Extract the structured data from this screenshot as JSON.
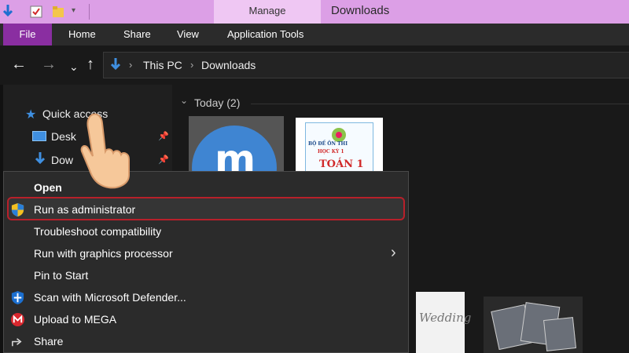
{
  "titlebar": {
    "manage_tab": "Manage",
    "window_title": "Downloads"
  },
  "ribbon": {
    "file": "File",
    "home": "Home",
    "share": "Share",
    "view": "View",
    "app_tools": "Application Tools"
  },
  "address": {
    "crumbs": [
      "This PC",
      "Downloads"
    ]
  },
  "navpane": {
    "quick_access": "Quick access",
    "desktop": "Desk",
    "downloads": "Dow"
  },
  "content": {
    "group_header": "Today (2)",
    "doc_line1": "BỘ ĐỀ ÔN THI",
    "doc_line2": "HỌC KỲ 1",
    "doc_line3": "TOÁN 1",
    "wedding_text": "Wedding"
  },
  "context_menu": {
    "items": [
      {
        "label": "Open",
        "icon": ""
      },
      {
        "label": "Run as administrator",
        "icon": "uac-shield-icon"
      },
      {
        "label": "Troubleshoot compatibility",
        "icon": ""
      },
      {
        "label": "Run with graphics processor",
        "icon": ""
      },
      {
        "label": "Pin to Start",
        "icon": ""
      },
      {
        "label": "Scan with Microsoft Defender...",
        "icon": "defender-icon"
      },
      {
        "label": "Upload to MEGA",
        "icon": "mega-icon"
      },
      {
        "label": "Share",
        "icon": "share-icon"
      }
    ]
  },
  "colors": {
    "titlebar": "#dc9fe6",
    "file_tab": "#8a2ea1",
    "highlight_border": "#b8202a"
  }
}
